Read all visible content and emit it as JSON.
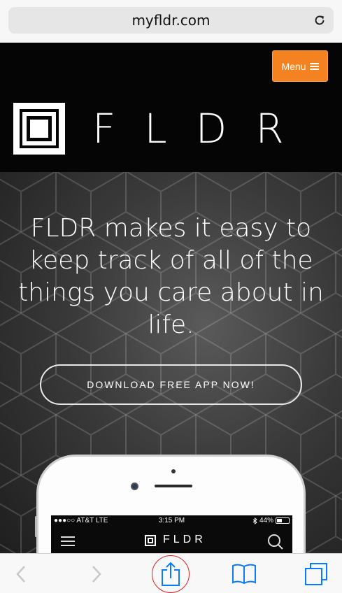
{
  "browser": {
    "url": "myfldr.com",
    "accent_color": "#0a7aff"
  },
  "site": {
    "menu_label": "Menu",
    "menu_color": "#f58220",
    "logo_text": "FLDR"
  },
  "hero": {
    "headline": "FLDR makes it easy to keep track of all of the things you care about in life.",
    "cta_label": "DOWNLOAD FREE APP NOW!"
  },
  "phone": {
    "status": {
      "carrier": "●●●○○ AT&T  LTE",
      "time": "3:15 PM",
      "battery": "44%",
      "battery_level": 0.44
    },
    "app_title": "FLDR"
  },
  "toolbar": {
    "items": [
      "back-icon",
      "forward-icon",
      "share-icon",
      "bookmarks-icon",
      "tabs-icon"
    ]
  }
}
